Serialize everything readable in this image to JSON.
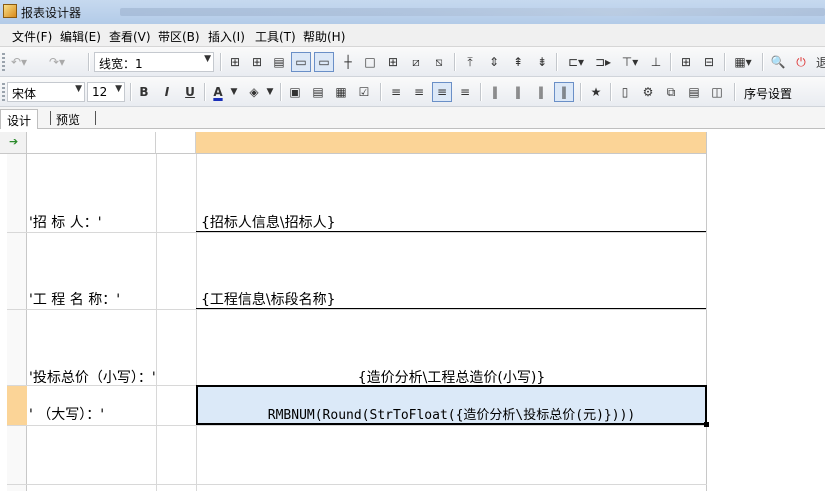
{
  "window": {
    "title": "报表设计器"
  },
  "menu": [
    "文件(F)",
    "编辑(E)",
    "查看(V)",
    "带区(B)",
    "插入(I)",
    "工具(T)",
    "帮助(H)"
  ],
  "toolbar1": {
    "line_width_label": "线宽：1"
  },
  "toolbar2": {
    "font_name": "宋体",
    "font_size": "12",
    "bold": "B",
    "italic": "I",
    "underline": "U",
    "font_color": "A",
    "sequence_settings": "序号设置"
  },
  "tabs": [
    "设计",
    "预览"
  ],
  "report": {
    "row1_label": "'招      标      人：'",
    "row1_value": "{招标人信息\\招标人}",
    "row2_label": "'工   程    名  称：'",
    "row2_value": "{工程信息\\标段名称}",
    "row3_label": "'投标总价（小写）：'",
    "row3_value": "{造价分析\\工程总造价(小写)}",
    "row4_label": "'         （大写）：'",
    "row4_value": "RMBNUM(Round(StrToFloat({造价分析\\投标总价(元)})))"
  },
  "colors": {
    "header_band": "#fbd497",
    "selection_fill": "#dbe9f8",
    "selection_border": "#000000",
    "row_highlight": "#fbd497"
  }
}
